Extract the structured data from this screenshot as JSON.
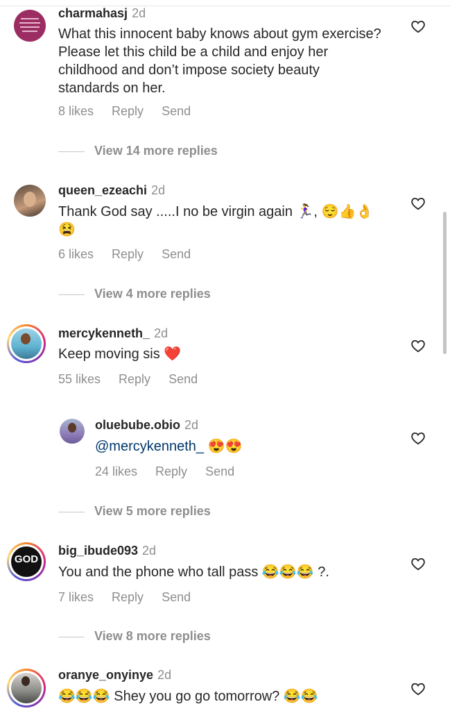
{
  "comments": [
    {
      "username": "charmahasj",
      "time": "2d",
      "text": "What this innocent baby knows about gym exercise? Please let this child be a child and enjoy her childhood and don’t impose society beauty standards on her.",
      "likes": "8 likes",
      "reply": "Reply",
      "send": "Send",
      "view_more": "View 14 more replies"
    },
    {
      "username": "queen_ezeachi",
      "time": "2d",
      "text": "Thank God say .....I no be virgin again 🏃‍♀️, 😌👍👌😫",
      "likes": "6 likes",
      "reply": "Reply",
      "send": "Send",
      "view_more": "View 4 more replies"
    },
    {
      "username": "mercykenneth_",
      "time": "2d",
      "text": "Keep moving sis ❤️",
      "likes": "55 likes",
      "reply": "Reply",
      "send": "Send",
      "reply_comment": {
        "username": "oluebube.obio",
        "time": "2d",
        "mention": "@mercykenneth_",
        "text": " 😍😍",
        "likes": "24 likes",
        "reply": "Reply",
        "send": "Send"
      },
      "view_more": "View 5 more replies"
    },
    {
      "username": "big_ibude093",
      "time": "2d",
      "avatar_text": "GOD",
      "text": "You and the phone who tall pass 😂😂😂 ?.",
      "likes": "7 likes",
      "reply": "Reply",
      "send": "Send",
      "view_more": "View 8 more replies"
    },
    {
      "username": "oranye_onyinye",
      "time": "2d",
      "text": "😂😂😂 Shey you go go tomorrow? 😂😂"
    }
  ],
  "colors": {
    "text": "#262626",
    "secondary": "#8e8e8e",
    "mention": "#00376b",
    "heart_red": "#e0245e"
  },
  "icons": {
    "like": "heart-outline-icon"
  }
}
